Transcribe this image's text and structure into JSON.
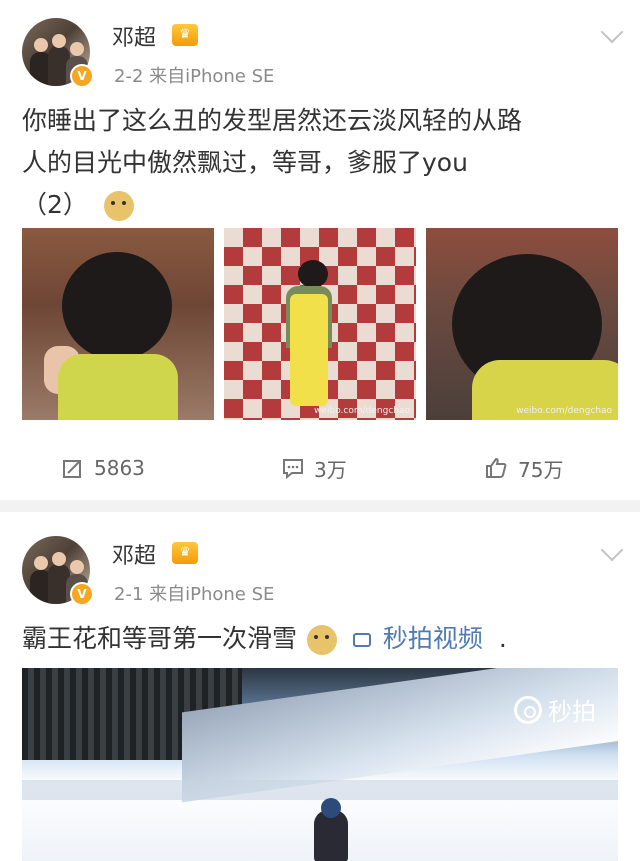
{
  "posts": [
    {
      "username": "邓超",
      "meta": "2-2  来自iPhone SE",
      "text_line1": "你睡出了这么丑的发型居然还云淡风轻的从路",
      "text_line2": "人的目光中傲然飘过，等哥，爹服了you",
      "text_line3": "（2）",
      "photo_watermark": "weibo.com/dengchao",
      "actions": {
        "repost": "5863",
        "comment": "3万",
        "like": "75万"
      }
    },
    {
      "username": "邓超",
      "meta": "2-1  来自iPhone SE",
      "text": "霸王花和等哥第一次滑雪",
      "video_link": "秒拍视频",
      "trailing": ".",
      "video_badge": "秒拍"
    }
  ],
  "icons": [
    "avatar",
    "crown-icon",
    "chevron-down-icon",
    "doge-emoji",
    "repost-icon",
    "comment-icon",
    "like-icon",
    "video-icon",
    "miaopai-icon"
  ],
  "colors": {
    "accent": "#4e7bb6",
    "crown": "#f5a623",
    "text": "#333333",
    "meta": "#8a8a8a"
  }
}
